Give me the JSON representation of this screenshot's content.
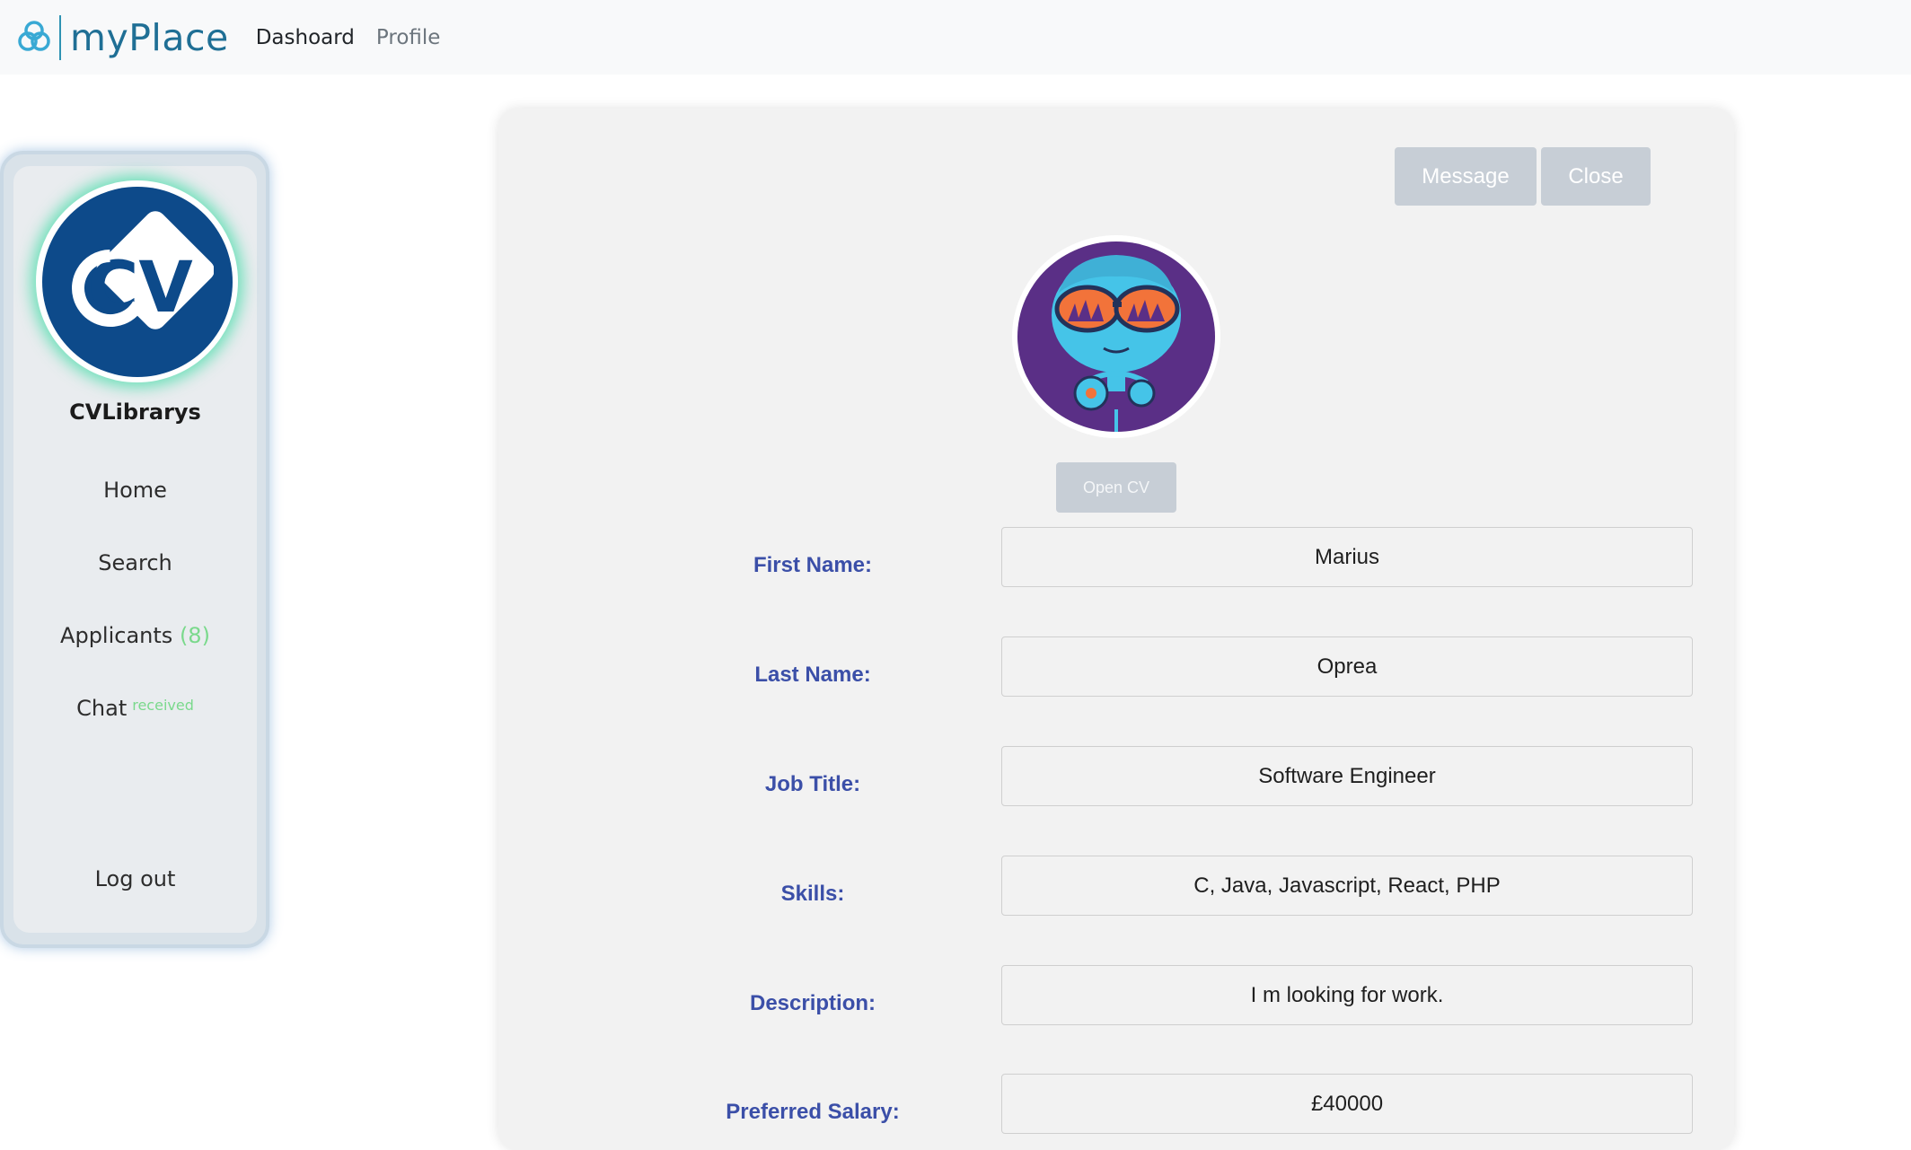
{
  "header": {
    "brand": "myPlace",
    "nav": [
      {
        "label": "Dashoard"
      },
      {
        "label": "Profile"
      }
    ]
  },
  "sidebar": {
    "company_name": "CVLibrarys",
    "avatar_text": "CV",
    "items": [
      {
        "label": "Home"
      },
      {
        "label": "Search"
      },
      {
        "label": "Applicants",
        "count": "(8)"
      },
      {
        "label": "Chat",
        "badge": "received"
      },
      {
        "label": "Log out"
      }
    ]
  },
  "profile": {
    "buttons": {
      "message": "Message",
      "close": "Close",
      "open_cv": "Open CV"
    },
    "fields": [
      {
        "label": "First Name:",
        "value": "Marius"
      },
      {
        "label": "Last Name:",
        "value": "Oprea"
      },
      {
        "label": "Job Title:",
        "value": "Software Engineer"
      },
      {
        "label": "Skills:",
        "value": "C, Java, Javascript, React, PHP"
      },
      {
        "label": "Description:",
        "value": "I m looking for work."
      },
      {
        "label": "Preferred Salary:",
        "value": "£40000"
      }
    ]
  },
  "colors": {
    "label": "#3b4fa8",
    "button_bg": "#c7ced6",
    "accent_green": "#7ad98c",
    "brand_blue": "#1f6f95"
  }
}
